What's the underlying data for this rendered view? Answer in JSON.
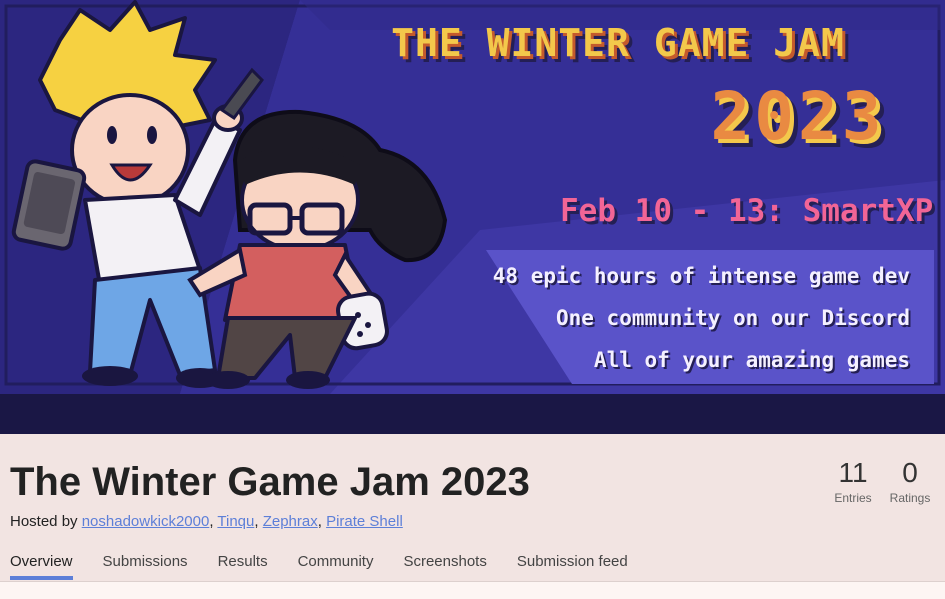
{
  "banner": {
    "title": "THE WINTER GAME JAM",
    "year": "2023",
    "date_line": "Feb 10 - 13: SmartXP",
    "taglines": [
      "48 epic hours of intense game dev",
      "One community on our Discord",
      "All of your amazing games"
    ],
    "colors": {
      "panel": "#3e37a4",
      "panel_dark": "#2c2680",
      "title": "#f3c84b",
      "year": "#e98a42",
      "date": "#f26596",
      "tagline_box": "#5a53c9"
    }
  },
  "jam": {
    "title": "The Winter Game Jam 2023",
    "hosted_by_label": "Hosted by",
    "hosts": [
      "noshadowkick2000",
      "Tinqu",
      "Zephrax",
      "Pirate Shell"
    ],
    "host_separator": ", ",
    "stats": {
      "entries": {
        "value": "11",
        "label": "Entries"
      },
      "ratings": {
        "value": "0",
        "label": "Ratings"
      }
    }
  },
  "tabs": [
    {
      "label": "Overview",
      "active": true
    },
    {
      "label": "Submissions",
      "active": false
    },
    {
      "label": "Results",
      "active": false
    },
    {
      "label": "Community",
      "active": false
    },
    {
      "label": "Screenshots",
      "active": false
    },
    {
      "label": "Submission feed",
      "active": false
    }
  ],
  "accent_color": "#5d7fd8"
}
